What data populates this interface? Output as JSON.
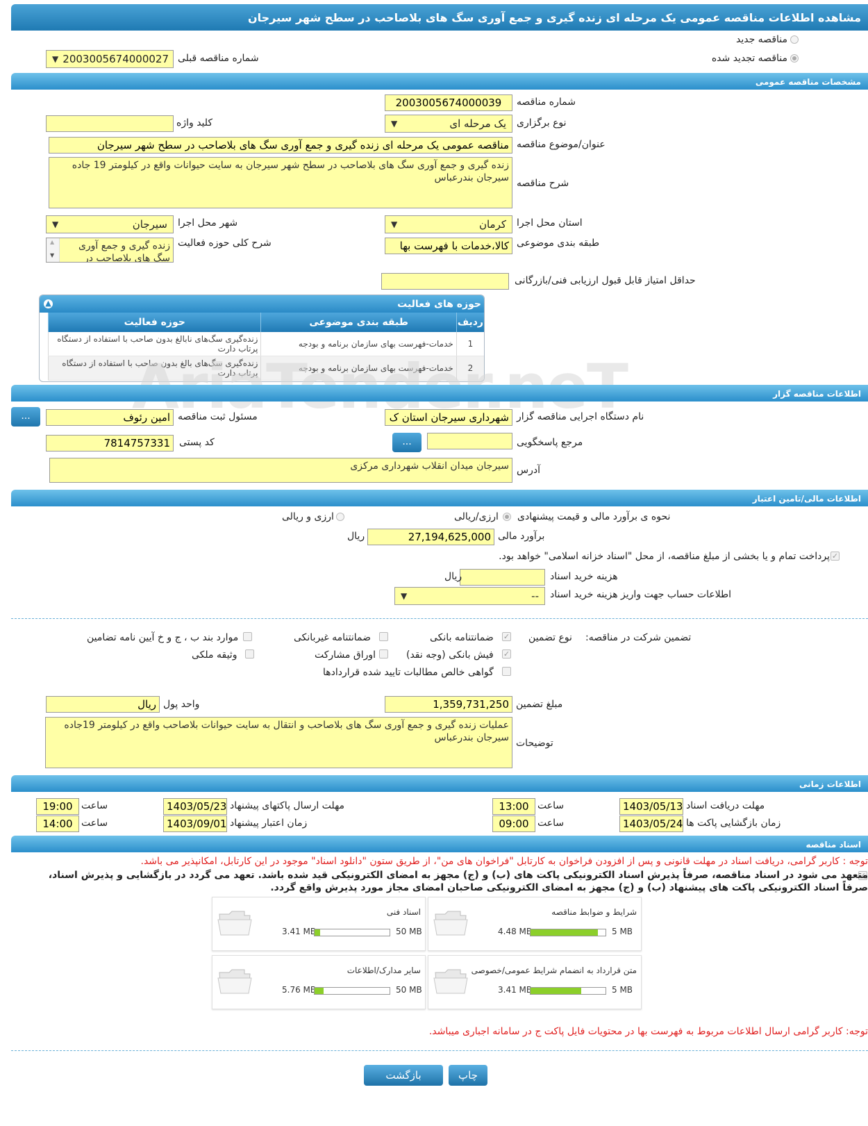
{
  "page_title": "مشاهده اطلاعات مناقصه عمومی یک مرحله ای زنده گیری و جمع آوری سگ های بلاصاحب در سطح شهر سیرجان",
  "status": {
    "new_label": "مناقصه جدید",
    "renewed_label": "مناقصه تجدید شده",
    "prev_number_label": "شماره مناقصه قبلی",
    "prev_number_value": "2003005674000027"
  },
  "sections": {
    "general": "مشخصات مناقصه عمومی",
    "organizer": "اطلاعات مناقصه گزار",
    "finance": "اطلاعات مالی/تامین اعتبار",
    "time": "اطلاعات زمانی",
    "docs": "اسناد مناقصه"
  },
  "general": {
    "number_label": "شماره مناقصه",
    "number_value": "2003005674000039",
    "type_label": "نوع برگزاری",
    "type_value": "یک مرحله ای",
    "keyword_label": "کلید واژه",
    "keyword_value": "",
    "subject_label": "عنوان/موضوع مناقصه",
    "subject_value": "مناقصه عمومی یک مرحله ای زنده گیری و جمع آوری سگ های بلاصاحب در سطح شهر سیرجان",
    "desc_label": "شرح مناقصه",
    "desc_value": "زنده گیری و جمع آوری سگ های بلاصاحب در سطح شهر سیرجان به سایت حیوانات واقع در کیلومتر 19 جاده سیرجان بندرعباس",
    "province_label": "استان محل اجرا",
    "province_value": "کرمان",
    "city_label": "شهر محل اجرا",
    "city_value": "سیرجان",
    "category_label": "طبقه بندی موضوعی",
    "category_value": "کالا،خدمات با فهرست بها",
    "activity_label": "شرح کلی حوزه فعالیت",
    "activity_value": "زنده گیری و جمع آوری سگ های بلاصاحب در",
    "min_score_label": "حداقل امتیاز قابل قبول ارزیابی فنی/بازرگانی",
    "min_score_value": ""
  },
  "activity_panel": {
    "title": "حوزه های فعالیت",
    "columns": [
      "ردیف",
      "طبقه بندی موضوعی",
      "حوزه فعالیت"
    ],
    "rows": [
      {
        "idx": "1",
        "category": "خدمات-فهرست بهای سازمان برنامه و بودجه",
        "field": "زنده‌گیری سگ‌های نابالغ بدون صاحب با استفاده از دستگاه پرتاب دارت"
      },
      {
        "idx": "2",
        "category": "خدمات-فهرست بهای سازمان برنامه و بودجه",
        "field": "زنده‌گیری سگ‌های بالغ بدون صاحب با استفاده از دستگاه پرتاب دارت"
      }
    ]
  },
  "watermark": "AriaTender.neT",
  "organizer": {
    "org_label": "نام دستگاه اجرایی مناقصه گزار",
    "org_value": "شهرداری سیرجان استان ک",
    "officer_label": "مسئول ثبت مناقصه",
    "officer_value": "امین رئوف",
    "ref_label": "مرجع پاسخگویی",
    "ref_value": "",
    "postal_label": "کد پستی",
    "postal_value": "7814757331",
    "address_label": "آدرس",
    "address_value": "سیرجان میدان انقلاب شهرداری مرکزی",
    "dots": "..."
  },
  "finance": {
    "method_label": "نحوه ی برآورد مالی و قیمت پیشنهادی",
    "opt1": "ارزی/ریالی",
    "opt2": "ارزی و ریالی",
    "estimate_label": "برآورد مالی",
    "estimate_value": "27,194,625,000",
    "rial": "ریال",
    "treasury_note": "پرداخت تمام و یا بخشی از مبلغ مناقصه، از محل \"اسناد خزانه اسلامی\" خواهد بود.",
    "doc_cost_label": "هزینه خرید اسناد",
    "doc_cost_value": "",
    "account_label": "اطلاعات حساب جهت واریز هزینه خرید اسناد",
    "account_value": "--"
  },
  "guarantee": {
    "label": "تضمین شرکت در مناقصه:",
    "type_label": "نوع تضمین",
    "items": {
      "bank_guarantee": "ضمانتنامه بانکی",
      "non_bank": "ضمانتنامه غیربانکی",
      "clauses": "موارد بند ب ، ج و خ آیین نامه تضامین",
      "bank_receipt": "فیش بانکی (وجه نقد)",
      "bonds": "اوراق مشارکت",
      "property": "وثیقه ملکی",
      "certificate": "گواهی خالص مطالبات تایید شده قراردادها"
    },
    "amount_label": "مبلغ تضمین",
    "amount_value": "1,359,731,250",
    "currency_label": "واحد پول",
    "currency_value": "ریال",
    "notes_label": "توضیحات",
    "notes_value": "عملیات زنده گیری و جمع آوری سگ های بلاصاحب و انتقال به سایت حیوانات بلاصاحب واقع در کیلومتر 19جاده سیرجان بندرعباس"
  },
  "time": {
    "doc_deadline_label": "مهلت دریافت اسناد",
    "doc_deadline_date": "1403/05/13",
    "doc_deadline_time": "13:00",
    "send_deadline_label": "مهلت ارسال پاکتهای پیشنهاد",
    "send_deadline_date": "1403/05/23",
    "send_deadline_time": "19:00",
    "open_label": "زمان بازگشایی پاکت ها",
    "open_date": "1403/05/24",
    "open_time": "09:00",
    "validity_label": "زمان اعتبار پیشنهاد",
    "validity_date": "1403/09/01",
    "validity_time": "14:00",
    "hour_label": "ساعت"
  },
  "docs": {
    "notice1": "توجه : کاربر گرامی، دریافت اسناد در مهلت قانونی و پس از افزودن فراخوان به کارتابل \"فراخوان های من\"، از طریق ستون \"دانلود اسناد\" موجود در این کارتابل، امکانپذیر می باشد.",
    "commit_line1": "متعهد می شود در اسناد مناقصه، صرفاً پذیرش اسناد الکترونیکی پاکت های (ب) و (ج) مجهز به امضای الکترونیکی قید شده باشد. تعهد می گردد در بازگشایی و پذیرش اسناد،",
    "commit_line2": "صرفاً اسناد الکترونیکی پاکت های پیشنهاد (ب) و (ج) مجهز به امضای الکترونیکی صاحبان امضای مجاز مورد پذیرش واقع گردد.",
    "files": [
      {
        "name": "شرایط و ضوابط مناقصه",
        "used": "4.48 MB",
        "cap": "5 MB",
        "ratio": 0.896
      },
      {
        "name": "اسناد فنی",
        "used": "3.41 MB",
        "cap": "50 MB",
        "ratio": 0.068
      },
      {
        "name": "متن قرارداد به انضمام شرایط عمومی/خصوصی",
        "used": "3.41 MB",
        "cap": "5 MB",
        "ratio": 0.682
      },
      {
        "name": "سایر مدارک/اطلاعات",
        "used": "5.76 MB",
        "cap": "50 MB",
        "ratio": 0.115
      }
    ],
    "notice2": "توجه: کاربر گرامی ارسال اطلاعات مربوط به فهرست بها در محتویات فایل پاکت ج در سامانه اجباری میباشد."
  },
  "buttons": {
    "print": "چاپ",
    "back": "بازگشت"
  }
}
